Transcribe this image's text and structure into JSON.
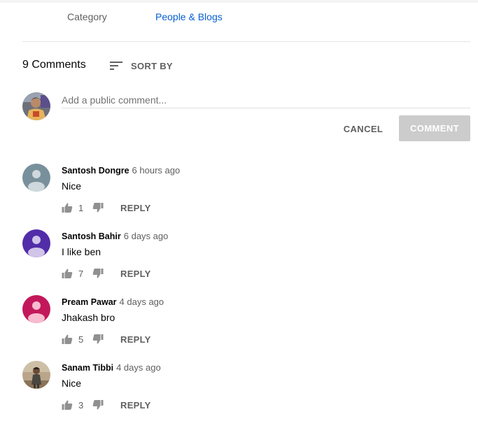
{
  "metadata": {
    "category_label": "Category",
    "category_value": "People & Blogs"
  },
  "comments_header": {
    "count_label": "9 Comments",
    "sort_label": "SORT BY"
  },
  "composer": {
    "placeholder": "Add a public comment...",
    "cancel_label": "CANCEL",
    "comment_label": "COMMENT"
  },
  "comments": [
    {
      "author": "Santosh Dongre",
      "time": "6 hours ago",
      "text": "Nice",
      "likes": "1",
      "reply_label": "REPLY",
      "avatar_color": "#78909c"
    },
    {
      "author": "Santosh Bahir",
      "time": "6 days ago",
      "text": "I like ben",
      "likes": "7",
      "reply_label": "REPLY",
      "avatar_color": "#512da8"
    },
    {
      "author": "Pream Pawar",
      "time": "4 days ago",
      "text": "Jhakash bro",
      "likes": "5",
      "reply_label": "REPLY",
      "avatar_color": "#c2185b"
    },
    {
      "author": "Sanam Tibbi",
      "time": "4 days ago",
      "text": "Nice",
      "likes": "3",
      "reply_label": "REPLY",
      "avatar_color": "photo"
    }
  ],
  "colors": {
    "link": "#065fd4",
    "secondary_text": "#606060",
    "disabled_button": "#cccccc"
  }
}
